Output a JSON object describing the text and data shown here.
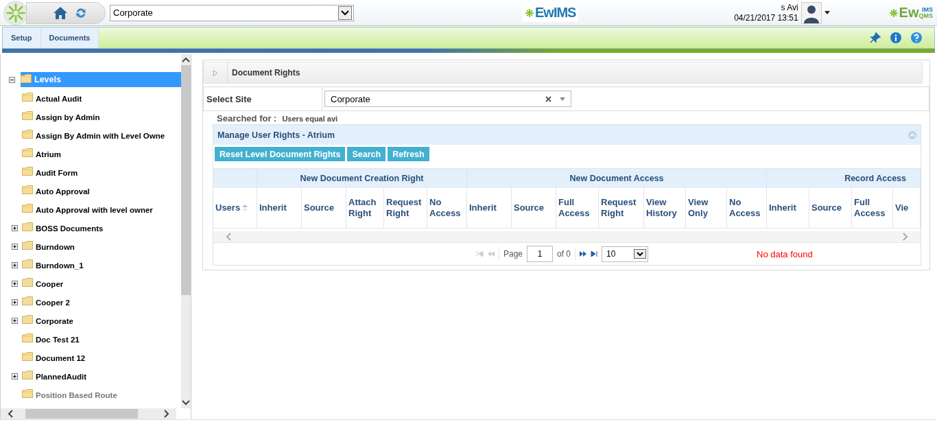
{
  "header": {
    "site_select": {
      "value": "Corporate"
    },
    "logo_center": {
      "text": "EwIMS"
    },
    "user": {
      "name": "s Avi",
      "datetime": "04/21/2017 13:51"
    },
    "logo_right": {
      "text": "Ew",
      "sub_top": "IMS",
      "sub_bottom": "QMS"
    }
  },
  "nav": {
    "tabs": [
      {
        "label": "Setup",
        "selected": false
      },
      {
        "label": "Documents",
        "selected": false
      }
    ]
  },
  "tree": {
    "items": [
      {
        "label": "Levels",
        "selected": true,
        "expanded": true,
        "children": [
          {
            "kind": "leaf",
            "label": "Actual Audit",
            "selected": false,
            "disabled": false
          },
          {
            "kind": "leaf",
            "label": "Assign by Admin",
            "selected": false,
            "disabled": false
          },
          {
            "kind": "leaf",
            "label": "Assign By Admin with Level Owne",
            "selected": false,
            "disabled": false
          },
          {
            "kind": "leaf",
            "label": "Atrium",
            "selected": false,
            "disabled": false
          },
          {
            "kind": "leaf",
            "label": "Audit Form",
            "selected": false,
            "disabled": false
          },
          {
            "kind": "leaf",
            "label": "Auto Approval",
            "selected": false,
            "disabled": false
          },
          {
            "kind": "leaf",
            "label": "Auto Approval with level owner",
            "selected": false,
            "disabled": false
          },
          {
            "kind": "folder",
            "label": "BOSS Documents",
            "selected": false,
            "expanded": false,
            "disabled": false
          },
          {
            "kind": "folder",
            "label": "Burndown",
            "selected": false,
            "expanded": false,
            "disabled": false
          },
          {
            "kind": "folder",
            "label": "Burndown_1",
            "selected": false,
            "expanded": false,
            "disabled": false
          },
          {
            "kind": "folder",
            "label": "Cooper",
            "selected": false,
            "expanded": false,
            "disabled": false
          },
          {
            "kind": "folder",
            "label": "Cooper 2",
            "selected": false,
            "expanded": false,
            "disabled": false
          },
          {
            "kind": "folder",
            "label": "Corporate",
            "selected": false,
            "expanded": false,
            "disabled": false
          },
          {
            "kind": "leaf",
            "label": "Doc Test 21",
            "selected": false,
            "disabled": false
          },
          {
            "kind": "leaf",
            "label": "Document 12",
            "selected": false,
            "disabled": false
          },
          {
            "kind": "folder",
            "label": "PlannedAudit",
            "selected": false,
            "expanded": false,
            "disabled": false
          },
          {
            "kind": "leaf",
            "label": "Position Based Route",
            "selected": false,
            "disabled": true
          }
        ]
      }
    ]
  },
  "panel": {
    "title": "Document Rights",
    "site_label": "Select Site",
    "site_value": "Corporate",
    "searched_label": "Searched for :",
    "searched_value": "Users equal avi",
    "grid": {
      "title": "Manage User Rights - Atrium",
      "buttons": [
        "Reset Level Document Rights",
        "Search",
        "Refresh"
      ],
      "groups": [
        {
          "columns": [
            {
              "label": "Users",
              "sorted": true
            }
          ]
        },
        {
          "label": "New Document Creation Right",
          "columns": [
            {
              "label": "Inherit",
              "sorted": false
            },
            {
              "label": "Source",
              "sorted": false
            },
            {
              "label": "Attach Right",
              "sorted": false
            },
            {
              "label": "Request Right",
              "sorted": false
            },
            {
              "label": "No Access",
              "sorted": false
            }
          ]
        },
        {
          "label": "New Document Access",
          "columns": [
            {
              "label": "Inherit",
              "sorted": false
            },
            {
              "label": "Source",
              "sorted": false
            },
            {
              "label": "Full Access",
              "sorted": false
            },
            {
              "label": "Request Right",
              "sorted": false
            },
            {
              "label": "View History",
              "sorted": false
            },
            {
              "label": "View Only",
              "sorted": false
            },
            {
              "label": "No Access",
              "sorted": false
            }
          ]
        },
        {
          "label": "Record Access",
          "columns": [
            {
              "label": "Inherit",
              "sorted": false
            },
            {
              "label": "Source",
              "sorted": false
            },
            {
              "label": "Full Access",
              "sorted": false
            },
            {
              "label": "Vie",
              "sorted": false
            }
          ]
        }
      ],
      "pager": {
        "page_label": "Page",
        "page": "1",
        "of": "of 0",
        "page_size": "10",
        "message": "No data found"
      }
    }
  }
}
